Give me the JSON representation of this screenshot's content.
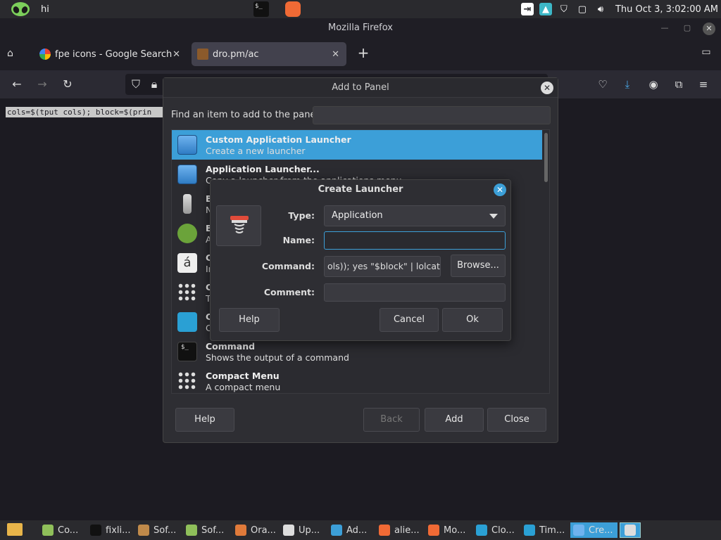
{
  "top_panel": {
    "user_label": "hi",
    "clock": "Thu Oct  3, 3:02:00 AM"
  },
  "firefox": {
    "window_title": "Mozilla Firefox",
    "tabs": [
      {
        "label": "fpe icons - Google Search"
      },
      {
        "label": "dro.pm/ac"
      }
    ],
    "page_text": "cols=$(tput cols); block=$(prin"
  },
  "add_panel": {
    "title": "Add to Panel",
    "find_label": "Find an item to add to the panel:",
    "items": [
      {
        "name": "Custom Application Launcher",
        "desc": "Create a new launcher",
        "selected": true
      },
      {
        "name": "Application Launcher...",
        "desc": "Copy a launcher from the applications menu"
      },
      {
        "name": "B",
        "desc": "N"
      },
      {
        "name": "B",
        "desc": "A"
      },
      {
        "name": "C",
        "desc": "In"
      },
      {
        "name": "C",
        "desc": "T"
      },
      {
        "name": "C",
        "desc": "C"
      },
      {
        "name": "Command",
        "desc": "Shows the output of a command"
      },
      {
        "name": "Compact Menu",
        "desc": "A compact menu"
      }
    ],
    "buttons": {
      "help": "Help",
      "back": "Back",
      "add": "Add",
      "close": "Close"
    }
  },
  "create_launcher": {
    "title": "Create Launcher",
    "type_label": "Type:",
    "type_value": "Application",
    "name_label": "Name:",
    "name_value": "",
    "command_label": "Command:",
    "command_value": "ols)); yes \"$block\" | lolcat",
    "browse_label": "Browse...",
    "comment_label": "Comment:",
    "comment_value": "",
    "buttons": {
      "help": "Help",
      "cancel": "Cancel",
      "ok": "Ok"
    }
  },
  "taskbar": {
    "tasks": [
      {
        "label": "Co..."
      },
      {
        "label": "fixli..."
      },
      {
        "label": "Sof..."
      },
      {
        "label": "Sof..."
      },
      {
        "label": "Ora..."
      },
      {
        "label": "Up..."
      },
      {
        "label": "Ad..."
      },
      {
        "label": "alie..."
      },
      {
        "label": "Mo..."
      },
      {
        "label": "Clo..."
      },
      {
        "label": "Tim..."
      },
      {
        "label": "Cre..."
      }
    ]
  }
}
